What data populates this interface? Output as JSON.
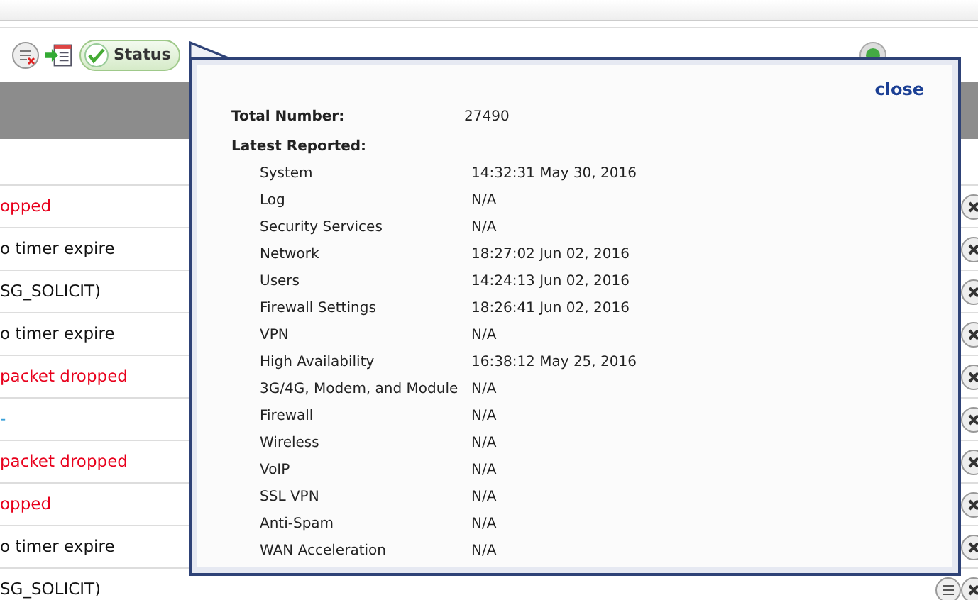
{
  "toolbar": {
    "status_button": "Status"
  },
  "rows": [
    {
      "text": "opped",
      "kind": "error"
    },
    {
      "text": "o timer expire",
      "kind": "normal"
    },
    {
      "text": "SG_SOLICIT)",
      "kind": "normal"
    },
    {
      "text": "o timer expire",
      "kind": "normal"
    },
    {
      "text": "packet dropped",
      "kind": "error"
    },
    {
      "text": "-",
      "kind": "link"
    },
    {
      "text": "packet dropped",
      "kind": "error"
    },
    {
      "text": "opped",
      "kind": "error"
    },
    {
      "text": "o timer expire",
      "kind": "normal"
    },
    {
      "text": "SG_SOLICIT)",
      "kind": "normal"
    }
  ],
  "popup": {
    "close": "close",
    "total_label": "Total Number:",
    "total_value": "27490",
    "latest_label": "Latest Reported:",
    "items": [
      {
        "name": "System",
        "time": "14:32:31 May 30, 2016"
      },
      {
        "name": "Log",
        "time": "N/A"
      },
      {
        "name": "Security Services",
        "time": "N/A"
      },
      {
        "name": "Network",
        "time": "18:27:02 Jun 02, 2016"
      },
      {
        "name": "Users",
        "time": "14:24:13 Jun 02, 2016"
      },
      {
        "name": "Firewall Settings",
        "time": "18:26:41 Jun 02, 2016"
      },
      {
        "name": "VPN",
        "time": "N/A"
      },
      {
        "name": "High Availability",
        "time": "16:38:12 May 25, 2016"
      },
      {
        "name": "3G/4G, Modem, and Module",
        "time": "N/A"
      },
      {
        "name": "Firewall",
        "time": "N/A"
      },
      {
        "name": "Wireless",
        "time": "N/A"
      },
      {
        "name": "VoIP",
        "time": "N/A"
      },
      {
        "name": "SSL VPN",
        "time": "N/A"
      },
      {
        "name": "Anti-Spam",
        "time": "N/A"
      },
      {
        "name": "WAN Acceleration",
        "time": "N/A"
      }
    ]
  }
}
